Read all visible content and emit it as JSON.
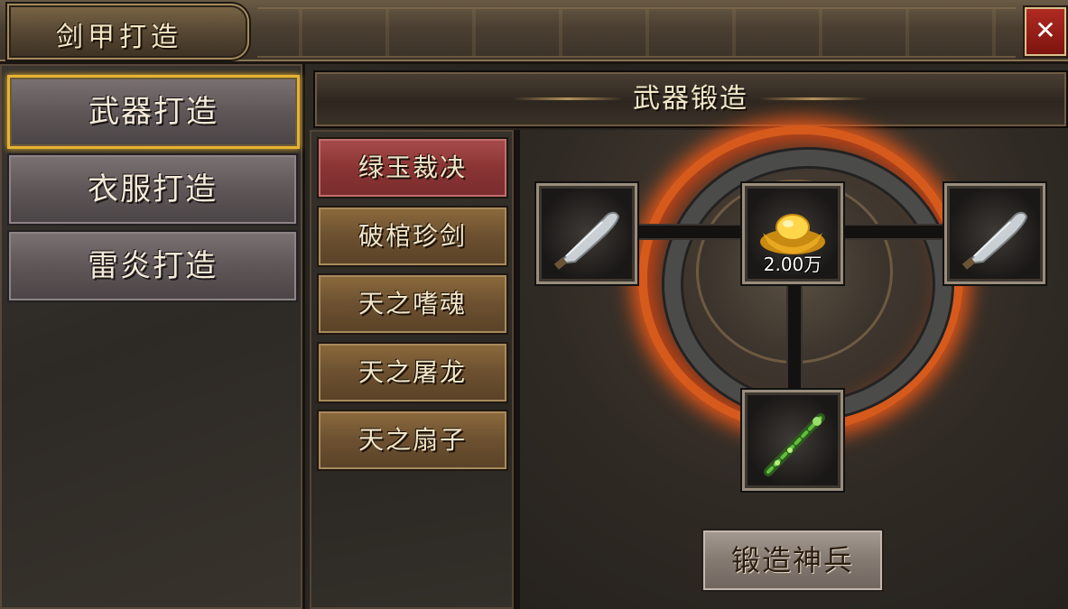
{
  "window": {
    "title": "剑甲打造",
    "close_icon": "✕"
  },
  "left_tabs": [
    {
      "label": "武器打造",
      "active": true
    },
    {
      "label": "衣服打造",
      "active": false
    },
    {
      "label": "雷炎打造",
      "active": false
    }
  ],
  "header": {
    "title": "武器锻造"
  },
  "weapon_list": [
    {
      "label": "绿玉裁决",
      "selected": true
    },
    {
      "label": "破棺珍剑",
      "selected": false
    },
    {
      "label": "天之嗜魂",
      "selected": false
    },
    {
      "label": "天之屠龙",
      "selected": false
    },
    {
      "label": "天之扇子",
      "selected": false
    }
  ],
  "forge": {
    "left_material": {
      "icon": "blade-weapon-icon"
    },
    "cost": {
      "icon": "gold-ingot-icon",
      "amount": "2.00万"
    },
    "right_material": {
      "icon": "blade-weapon-icon"
    },
    "result": {
      "icon": "green-jade-weapon-icon"
    }
  },
  "actions": {
    "forge_button": "锻造神兵"
  },
  "colors": {
    "active_tab_border": "#e7b330",
    "selected_item": "#8a3434",
    "close_button": "#9a1f18",
    "fire_ring": "#d65a1c"
  }
}
